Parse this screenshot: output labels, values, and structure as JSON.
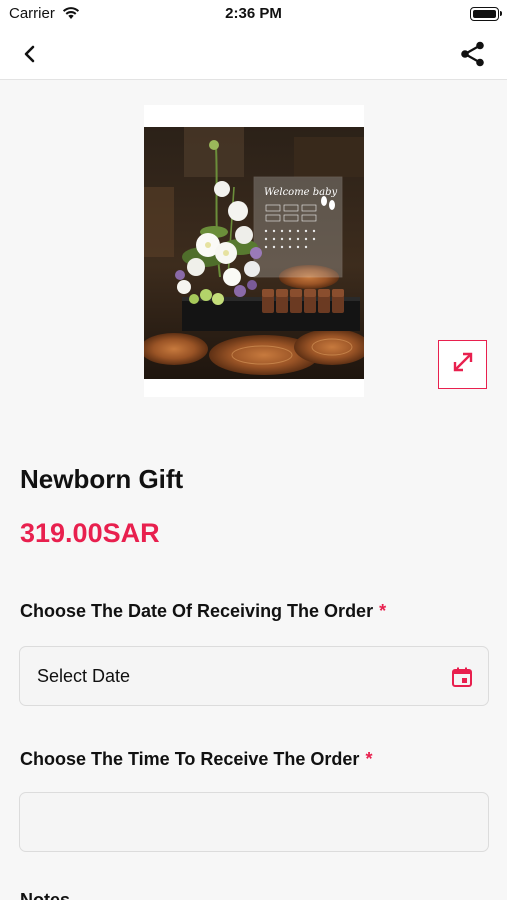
{
  "status_bar": {
    "carrier": "Carrier",
    "time": "2:36 PM"
  },
  "nav": {
    "back_icon": "chevron-left-icon",
    "share_icon": "share-icon"
  },
  "product": {
    "title": "Newborn Gift",
    "price": "319.00SAR",
    "image_sign_text": "Welcome baby",
    "expand_icon": "expand-icon"
  },
  "form": {
    "date": {
      "label": "Choose The Date Of Receiving The Order",
      "required_mark": "*",
      "value": "Select Date",
      "icon": "calendar-icon"
    },
    "time": {
      "label": "Choose The Time To Receive The Order",
      "required_mark": "*",
      "value": ""
    },
    "notes": {
      "label": "Notes"
    }
  },
  "colors": {
    "accent": "#e8204e",
    "background": "#f7f7f7"
  }
}
